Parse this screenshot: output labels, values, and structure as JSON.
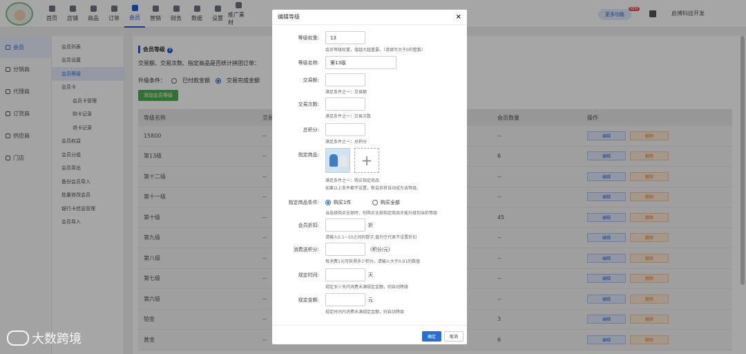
{
  "nav": {
    "items": [
      {
        "label": "首页",
        "icon": "home-icon"
      },
      {
        "label": "店铺",
        "icon": "store-icon"
      },
      {
        "label": "商品",
        "icon": "goods-icon"
      },
      {
        "label": "订单",
        "icon": "order-icon"
      },
      {
        "label": "会员",
        "icon": "member-icon"
      },
      {
        "label": "营销",
        "icon": "marketing-icon"
      },
      {
        "label": "财务",
        "icon": "finance-icon"
      },
      {
        "label": "数据",
        "icon": "data-icon"
      },
      {
        "label": "设置",
        "icon": "gear-icon"
      },
      {
        "label": "推广素材",
        "icon": "share-icon"
      }
    ],
    "active_label": "会员",
    "more_label": "更多功能",
    "new_badge": "NEW",
    "company": "启博科技开发"
  },
  "sidebar": {
    "items": [
      {
        "label": "会员",
        "active": true
      },
      {
        "label": "分销商"
      },
      {
        "label": "代理商"
      },
      {
        "label": "订货商"
      },
      {
        "label": "供应商"
      },
      {
        "label": "门店"
      }
    ]
  },
  "subnav": {
    "items": [
      {
        "label": "会员列表"
      },
      {
        "label": "会员设置"
      },
      {
        "label": "会员等级",
        "active": true
      },
      {
        "label": "会员卡"
      },
      {
        "label": "会员卡管理",
        "child": true
      },
      {
        "label": "购卡记录",
        "child": true
      },
      {
        "label": "退卡记录",
        "child": true
      },
      {
        "label": "会员权益"
      },
      {
        "label": "会员分组"
      },
      {
        "label": "会员导出"
      },
      {
        "label": "备份会员导入"
      },
      {
        "label": "批量修改会员"
      },
      {
        "label": "银行卡信息管理"
      },
      {
        "label": "会员导入"
      }
    ]
  },
  "content": {
    "title": "会员等级",
    "line1": "交易额、交易次数、指定商品是否统计拼团订单：",
    "upgrade_label": "升级条件：",
    "opt_paid": "已付款金额",
    "opt_done": "交易完成金额",
    "add_button": "添加会员等级",
    "table": {
      "headers": [
        "等级名称",
        "交易",
        "会员数量",
        "操作"
      ],
      "edit_label": "编辑",
      "delete_label": "删除",
      "rows": [
        {
          "name": "15800",
          "trade": "--",
          "count": "--"
        },
        {
          "name": "第13级",
          "trade": "--",
          "count": "6"
        },
        {
          "name": "第十二级",
          "trade": "--",
          "count": "--"
        },
        {
          "name": "第十一级",
          "trade": "--",
          "count": "--"
        },
        {
          "name": "第十级",
          "trade": "--",
          "count": "45"
        },
        {
          "name": "第九级",
          "trade": "--",
          "count": "--"
        },
        {
          "name": "第八级",
          "trade": "--",
          "count": "--"
        },
        {
          "name": "第七级",
          "trade": "--",
          "count": "--"
        },
        {
          "name": "第六级",
          "trade": "--",
          "count": "--"
        },
        {
          "name": "铂金",
          "trade": "--",
          "count": "3"
        },
        {
          "name": "黄金",
          "trade": "--",
          "count": "6"
        }
      ]
    }
  },
  "modal": {
    "title": "编辑等级",
    "weight_label": "等级权重:",
    "weight_value": "13",
    "weight_hint": "会员等级权重，值越大越重要。（请填写大于0的整数）",
    "name_label": "等级名称:",
    "name_value": "第13级",
    "trade_amount_label": "交易额:",
    "trade_amount_hint": "满足条件之一：交易额",
    "trade_count_label": "交易次数:",
    "trade_count_hint": "满足条件之一：交易次数",
    "points_label": "总积分:",
    "points_hint": "满足条件之一：总积分",
    "goods_label": "指定商品:",
    "goods_hint1": "满足条件之一：购买指定商品",
    "goods_hint2": "如果以上条件都不设置，新会员将自动成为该等级。",
    "goods_cond_label": "指定商品条件:",
    "buy_one": "购买1件",
    "buy_all": "购买全部",
    "goods_cond_hint": "当选择购买全部时，则购买全部指定商品才能升级到当前等级",
    "discount_label": "会员折扣:",
    "discount_unit": "折",
    "discount_hint": "请输入0.1~10之间的数字,值为空代表不设置折扣",
    "spend_points_label": "消费送积分:",
    "spend_points_unit": "(积分/元)",
    "spend_points_hint": "每消费1元可获得多少积分，请输入大于0.01的数值",
    "period_label": "规定时间:",
    "period_unit": "天",
    "period_hint": "规定多少天内消费未满规定金额，则自动降级",
    "amount_label": "规定金额:",
    "amount_unit": "元",
    "amount_hint": "规定时间内消费未满规定金额，则自动降级",
    "ok": "确定",
    "cancel": "取消"
  },
  "watermark": "大数跨境"
}
